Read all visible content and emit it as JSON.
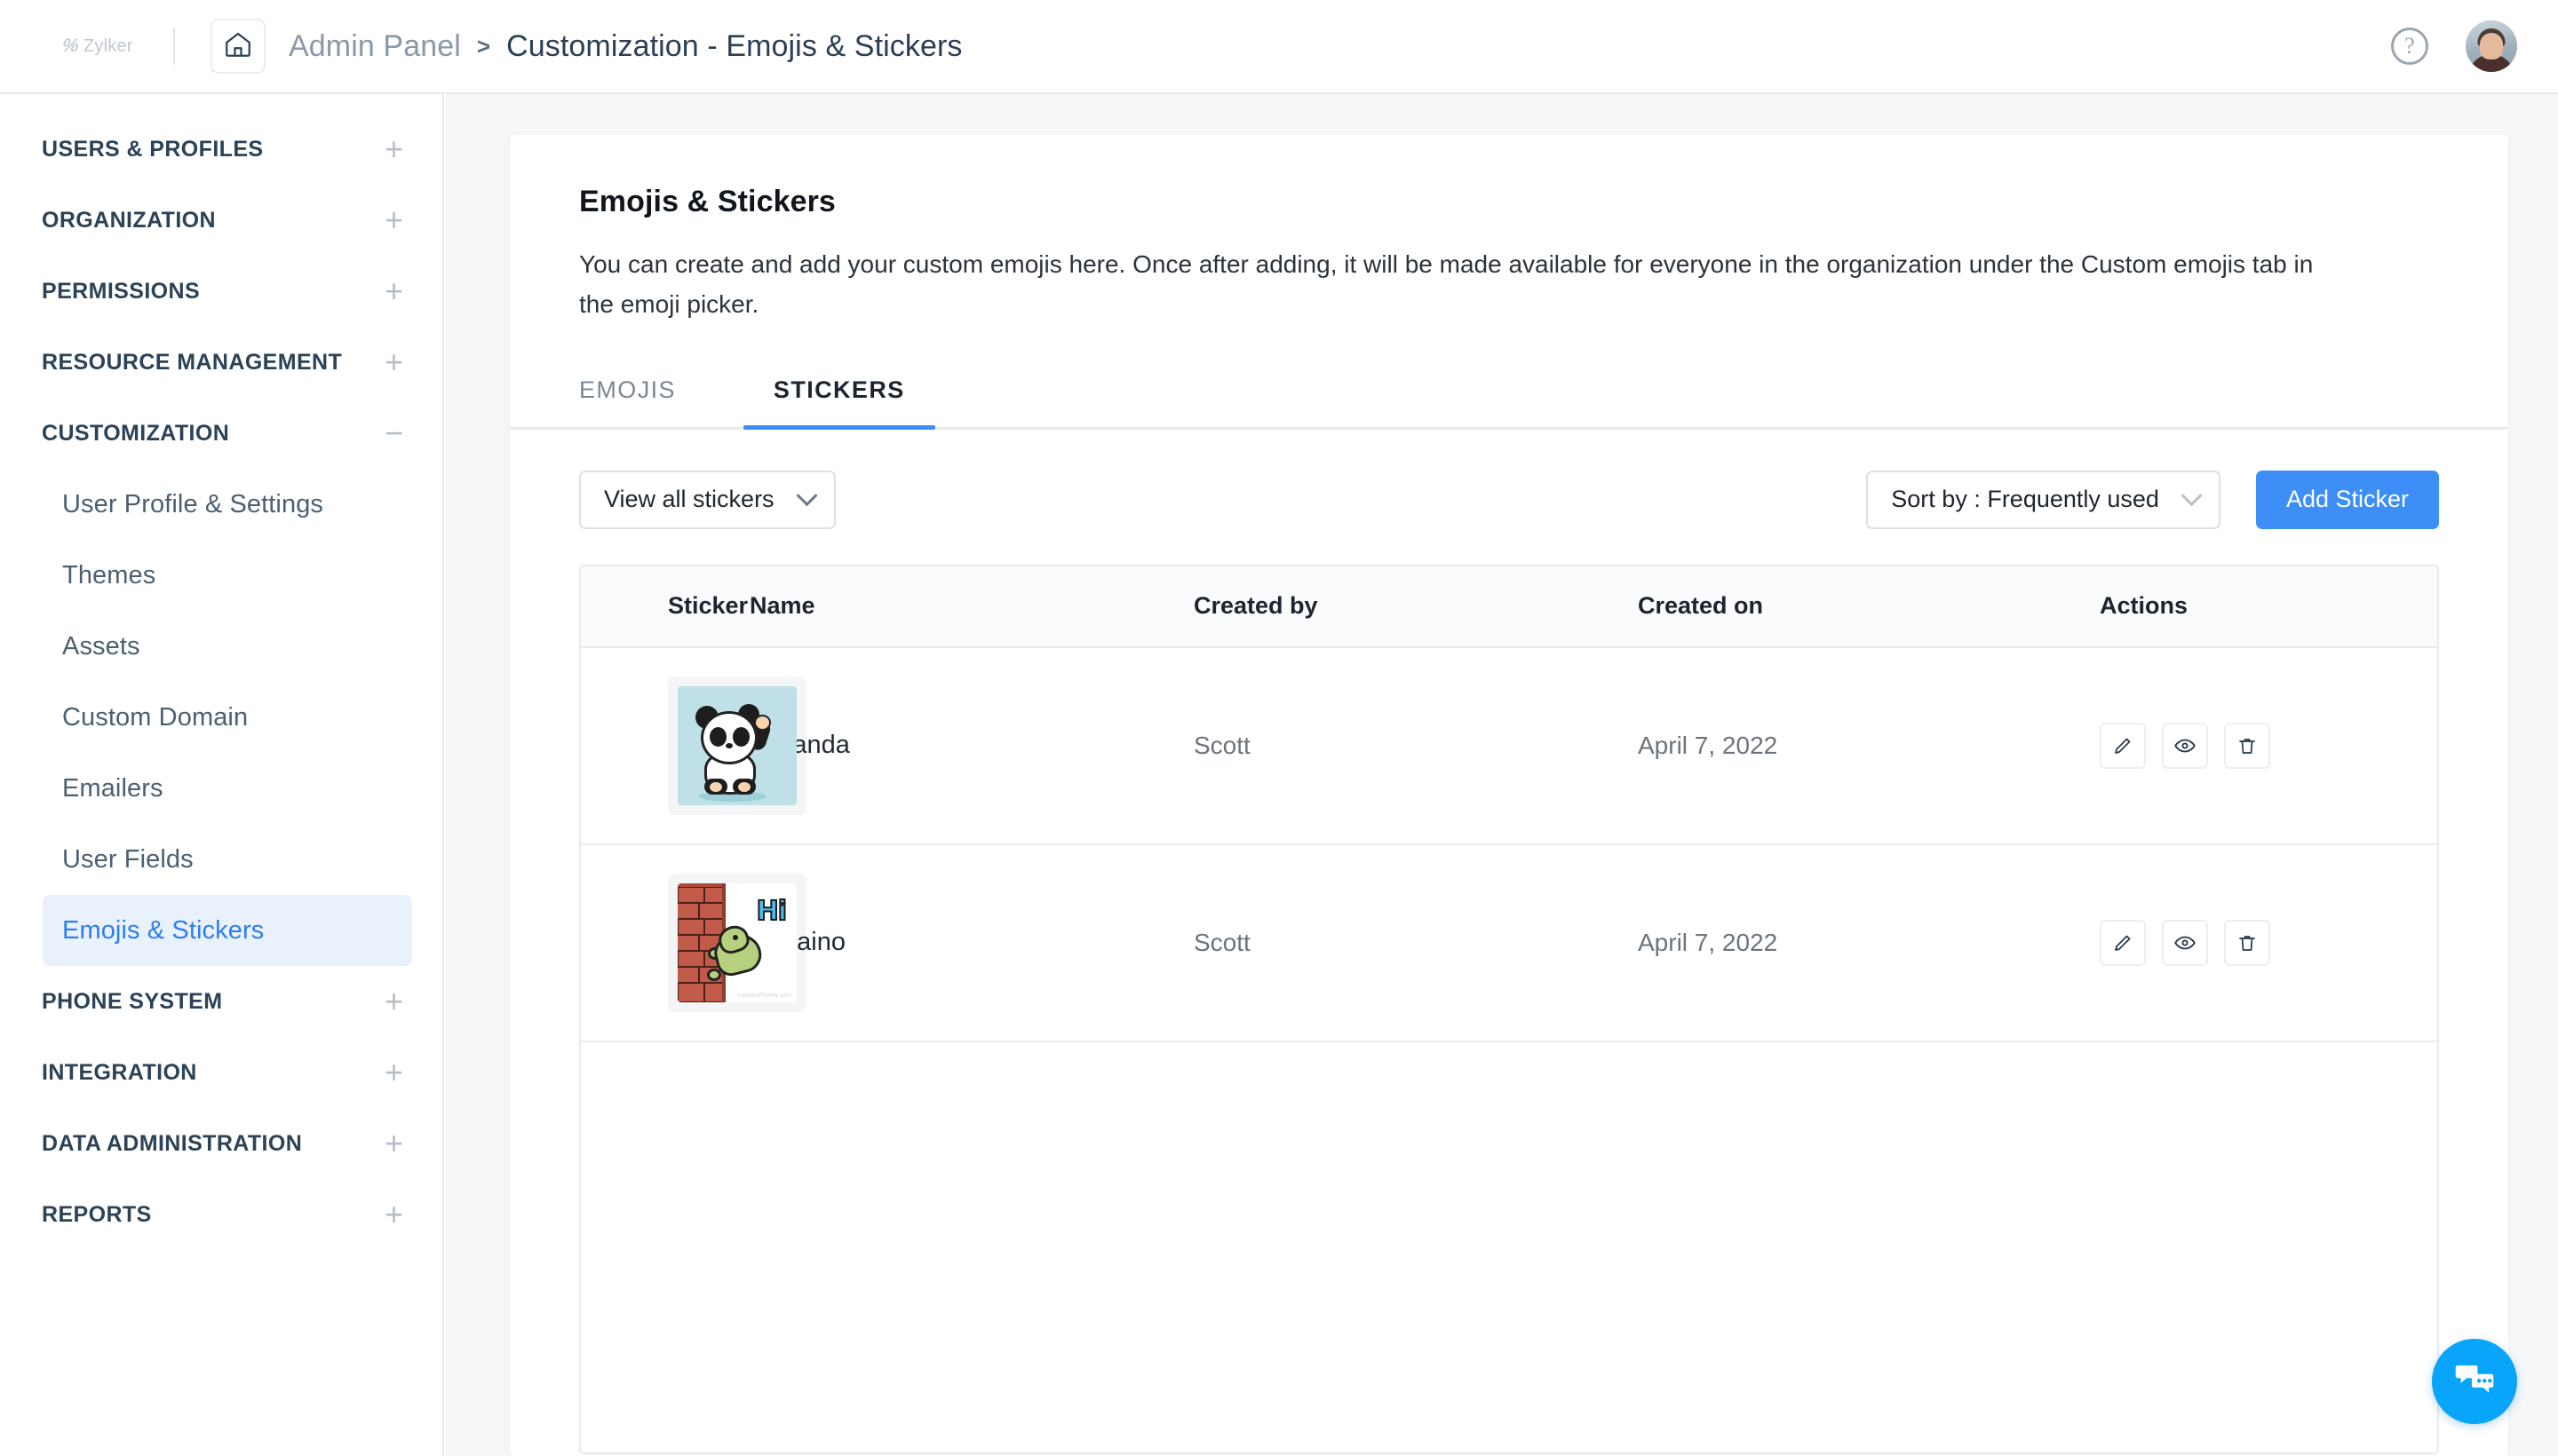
{
  "header": {
    "brand_mark": "%",
    "brand_name": "Zylker",
    "home_icon": "home-icon",
    "breadcrumb_root": "Admin Panel",
    "breadcrumb_separator": ">",
    "breadcrumb_current": "Customization - Emojis & Stickers",
    "help_icon_label": "?",
    "avatar_label": "user-avatar"
  },
  "sidebar": {
    "sections": [
      {
        "label": "USERS & PROFILES",
        "expander": "+",
        "expanded": false,
        "items": []
      },
      {
        "label": "ORGANIZATION",
        "expander": "+",
        "expanded": false,
        "items": []
      },
      {
        "label": "PERMISSIONS",
        "expander": "+",
        "expanded": false,
        "items": []
      },
      {
        "label": "RESOURCE MANAGEMENT",
        "expander": "+",
        "expanded": false,
        "items": []
      },
      {
        "label": "CUSTOMIZATION",
        "expander": "−",
        "expanded": true,
        "items": [
          {
            "label": "User Profile & Settings",
            "active": false
          },
          {
            "label": "Themes",
            "active": false
          },
          {
            "label": "Assets",
            "active": false
          },
          {
            "label": "Custom Domain",
            "active": false
          },
          {
            "label": "Emailers",
            "active": false
          },
          {
            "label": "User Fields",
            "active": false
          },
          {
            "label": "Emojis & Stickers",
            "active": true
          }
        ]
      },
      {
        "label": "PHONE SYSTEM",
        "expander": "+",
        "expanded": false,
        "items": []
      },
      {
        "label": "INTEGRATION",
        "expander": "+",
        "expanded": false,
        "items": []
      },
      {
        "label": "DATA ADMINISTRATION",
        "expander": "+",
        "expanded": false,
        "items": []
      },
      {
        "label": "REPORTS",
        "expander": "+",
        "expanded": false,
        "items": []
      }
    ]
  },
  "main": {
    "title": "Emojis & Stickers",
    "description": "You can create and add your custom emojis here. Once after adding, it will be made available for everyone in the organization under the Custom emojis tab in the emoji picker.",
    "tabs": [
      {
        "label": "EMOJIS",
        "active": false
      },
      {
        "label": "STICKERS",
        "active": true
      }
    ],
    "toolbar": {
      "view_filter": "View all stickers",
      "sort_by": "Sort by : Frequently used",
      "add_button": "Add Sticker"
    },
    "table": {
      "columns": [
        "Sticker",
        "Name",
        "Created by",
        "Created on",
        "Actions"
      ],
      "rows": [
        {
          "sticker": "hi-panda-image",
          "name": "hi-panda",
          "created_by": "Scott",
          "created_on": "April 7, 2022",
          "actions": [
            "edit-icon",
            "view-icon",
            "delete-icon"
          ]
        },
        {
          "sticker": "hi-daino-image",
          "name": "Hi-daino",
          "created_by": "Scott",
          "created_on": "April 7, 2022",
          "actions": [
            "edit-icon",
            "view-icon",
            "delete-icon"
          ]
        }
      ]
    }
  },
  "chat_widget": {
    "icon": "chat-bubbles-icon",
    "color": "#09a5fb"
  },
  "colors": {
    "accent_blue": "#3d8ef7",
    "sidebar_active_bg": "#e9f1fc",
    "sidebar_active_text": "#2d7ff0",
    "page_bg": "#f5f7f9",
    "heading": "#2c4256"
  }
}
